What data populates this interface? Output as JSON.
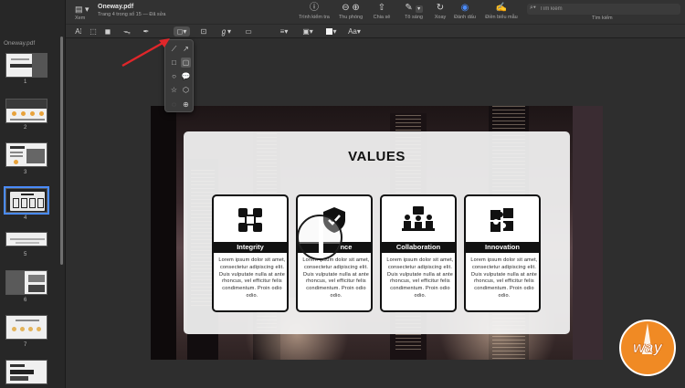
{
  "window": {
    "doc_title": "Oneway.pdf",
    "doc_subtitle": "Trang 4 trong số 15 — Đã sửa",
    "view_label": "Xem"
  },
  "toolbar": {
    "inspector": {
      "label": "Trình kiểm tra",
      "icon": "info-icon"
    },
    "zoom": {
      "label": "Thu phóng",
      "icon": "zoom-icon"
    },
    "share": {
      "label": "Chia sẻ",
      "icon": "share-icon"
    },
    "highlight": {
      "label": "Tô sáng",
      "icon": "pen-icon"
    },
    "rotate": {
      "label": "Xoay",
      "icon": "rotate-icon"
    },
    "markup": {
      "label": "Đánh dấu",
      "icon": "markup-icon"
    },
    "form_fill": {
      "label": "Điền biểu mẫu",
      "icon": "form-icon"
    },
    "search": {
      "placeholder": "Tìm kiếm",
      "label": "Tìm kiếm"
    }
  },
  "markup_bar": {
    "font_label": "Aa"
  },
  "sidebar": {
    "file_label": "Oneway.pdf",
    "pages": [
      {
        "num": "1",
        "title": "PROJECT"
      },
      {
        "num": "2",
        "title": ""
      },
      {
        "num": "3",
        "title": "ABOUT US"
      },
      {
        "num": "4",
        "title": "VALUES"
      },
      {
        "num": "5",
        "title": ""
      },
      {
        "num": "6",
        "title": ""
      },
      {
        "num": "7",
        "title": ""
      },
      {
        "num": "8",
        "title": ""
      }
    ],
    "selected_page": "4"
  },
  "slide": {
    "title": "VALUES",
    "cards": [
      {
        "name": "Integrity",
        "icon": "hands-icon",
        "text": "Lorem ipsum dolor sit amet, consectetur adipiscing elit. Duis vulputate nulla at ante rhoncus, vel efficitur felis condimentum. Proin odio odio."
      },
      {
        "name": "Excellence",
        "icon": "shield-check-icon",
        "text": "Lorem ipsum dolor sit amet, consectetur adipiscing elit. Duis vulputate nulla at ante rhoncus, vel efficitur felis condimentum. Proin odio odio."
      },
      {
        "name": "Collaboration",
        "icon": "meeting-icon",
        "text": "Lorem ipsum dolor sit amet, consectetur adipiscing elit. Duis vulputate nulla at ante rhoncus, vel efficitur felis condimentum. Proin odio odio."
      },
      {
        "name": "Innovation",
        "icon": "puzzle-icon",
        "text": "Lorem ipsum dolor sit amet, consectetur adipiscing elit. Duis vulputate nulla at ante rhoncus, vel efficitur felis condimentum. Proin odio odio."
      }
    ]
  },
  "logo": {
    "text": "way"
  },
  "colors": {
    "accent_arrow": "#e0262a",
    "logo_orange": "#f08a24"
  }
}
